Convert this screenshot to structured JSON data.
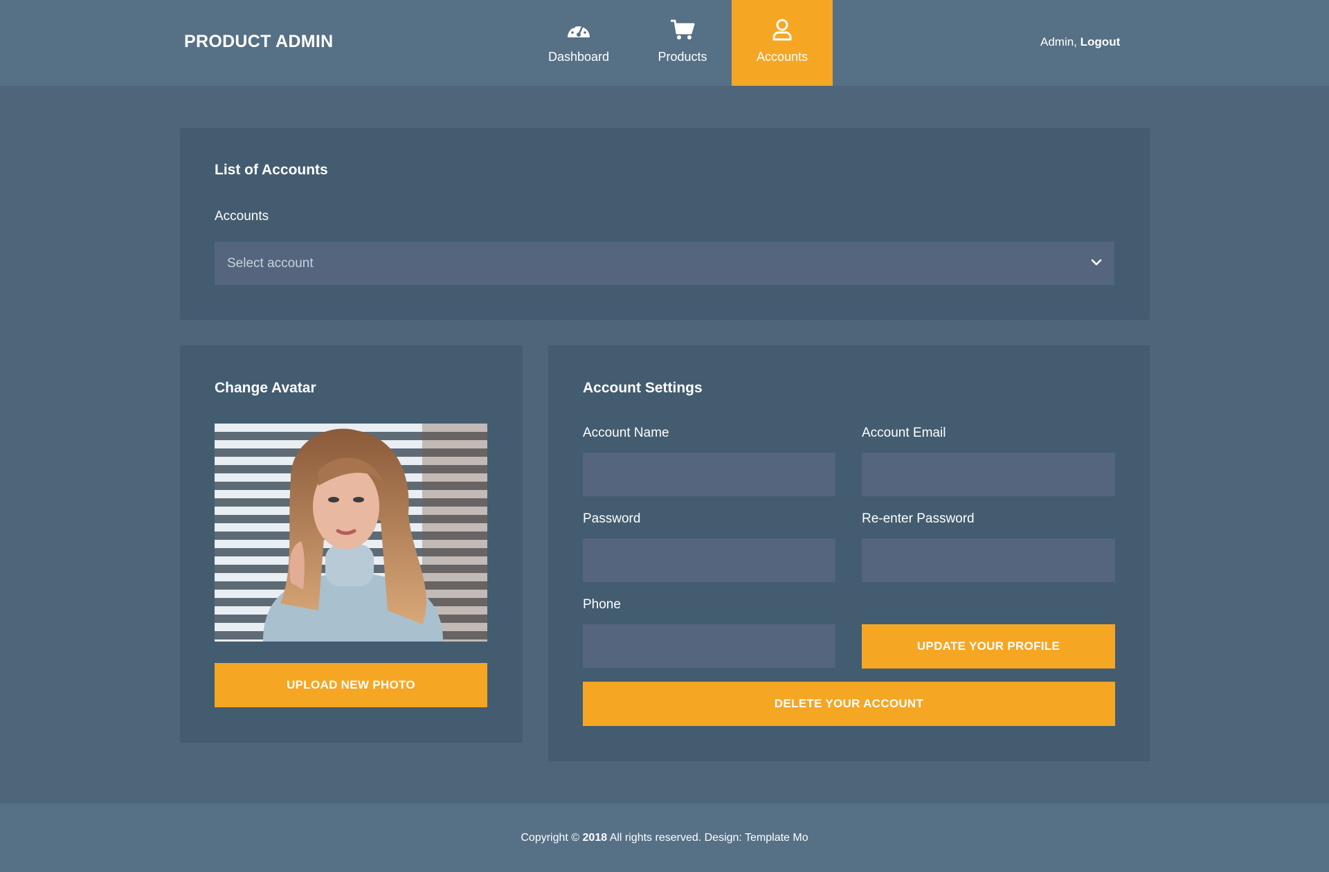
{
  "header": {
    "brand": "PRODUCT ADMIN",
    "nav": [
      {
        "label": "Dashboard",
        "icon": "dashboard-gauge-icon",
        "active": false
      },
      {
        "label": "Products",
        "icon": "shopping-cart-icon",
        "active": false
      },
      {
        "label": "Accounts",
        "icon": "user-icon",
        "active": true
      }
    ],
    "user": {
      "name": "Admin,",
      "logout": "Logout"
    }
  },
  "accounts_list": {
    "title": "List of Accounts",
    "field_label": "Accounts",
    "select_placeholder": "Select account"
  },
  "avatar": {
    "title": "Change Avatar",
    "upload_button": "UPLOAD NEW PHOTO"
  },
  "settings": {
    "title": "Account Settings",
    "account_name_label": "Account Name",
    "account_email_label": "Account Email",
    "password_label": "Password",
    "reenter_password_label": "Re-enter Password",
    "phone_label": "Phone",
    "account_name_value": "",
    "account_email_value": "",
    "password_value": "",
    "reenter_password_value": "",
    "phone_value": "",
    "update_button": "UPDATE YOUR PROFILE",
    "delete_button": "DELETE YOUR ACCOUNT"
  },
  "footer": {
    "prefix": "Copyright ©",
    "year": "2018",
    "suffix": "All rights reserved. Design: Template Mo"
  },
  "colors": {
    "accent": "#f5a623",
    "header_bg": "#567086",
    "page_bg": "#4e657a",
    "card_bg": "#435c70",
    "input_bg": "#54657d"
  }
}
